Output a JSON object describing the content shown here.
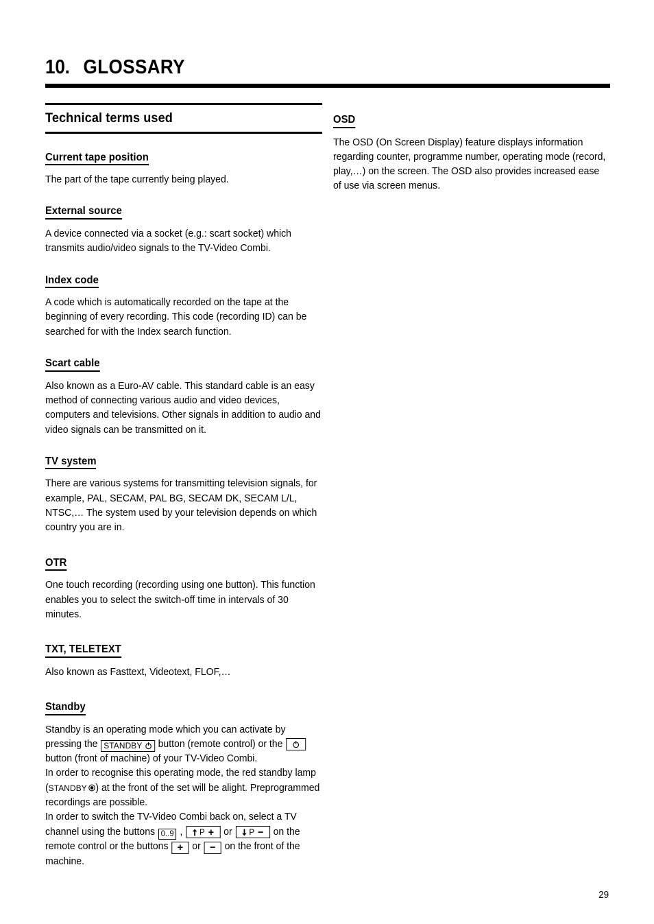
{
  "chapter": {
    "number": "10.",
    "title": "GLOSSARY"
  },
  "left_column": {
    "banner_title": "Technical terms used",
    "entries": [
      {
        "term": "Current tape position",
        "body": "The part of the tape currently being played."
      },
      {
        "term": "External source",
        "body": "A device connected via a socket (e.g.: scart socket) which transmits audio/video signals to the TV-Video Combi."
      },
      {
        "term": "Index code",
        "body": "A code which is automatically recorded on the tape at the beginning of every recording. This code (recording ID) can be searched for with the Index search function."
      },
      {
        "term": "Scart cable",
        "body": "Also known as a Euro-AV cable. This standard cable is an easy method of connecting various audio and video devices, computers and televisions. Other signals in addition to audio and video signals can be transmitted on it."
      },
      {
        "term": "TV system",
        "body": "There are various systems for transmitting television signals, for example, PAL, SECAM, PAL BG, SECAM DK, SECAM L/L, NTSC,… The system used by your television depends on which country you are in."
      },
      {
        "term": "OTR",
        "body": "One touch recording (recording using one button). This function enables you to select the switch-off time in intervals of 30 minutes."
      },
      {
        "term": "TXT, TELETEXT",
        "body": "Also known as Fasttext, Videotext, FLOF,…"
      }
    ],
    "standby": {
      "term": "Standby",
      "line1_a": "Standby is an operating mode which you can activate by pressing the ",
      "key_standby_label": "STANDBY",
      "line1_b": " button (remote control) or the ",
      "line1_c": " button (front of machine) of your TV-Video Combi.",
      "line2_a": "In order to recognise this operating mode, the red standby lamp (",
      "lamp_label": "STANDBY",
      "line2_b": ") at the front of the set will be alight. Preprogrammed recordings are possible.",
      "line3_a": "In order to switch the TV-Video Combi back on, select a TV channel using the buttons ",
      "key_digits_label": "0..9",
      "line3_b": " , ",
      "key_prog_up_label": "P",
      "key_prog_up_sign": "+",
      "line3_c": " or ",
      "key_prog_down_label": "P",
      "key_prog_down_sign": "−",
      "line3_d": " on the remote control or the buttons ",
      "key_plus_sign": "+",
      "line3_e": " or ",
      "key_minus_sign": "−",
      "line3_f": " on the front of the machine."
    }
  },
  "right_column": {
    "entries": [
      {
        "term": "OSD",
        "body": "The OSD (On Screen Display) feature displays information regarding counter, programme number, operating mode (record, play,…) on the screen. The OSD also provides increased ease of use via screen menus."
      }
    ]
  },
  "footer": {
    "page_number": "29"
  }
}
